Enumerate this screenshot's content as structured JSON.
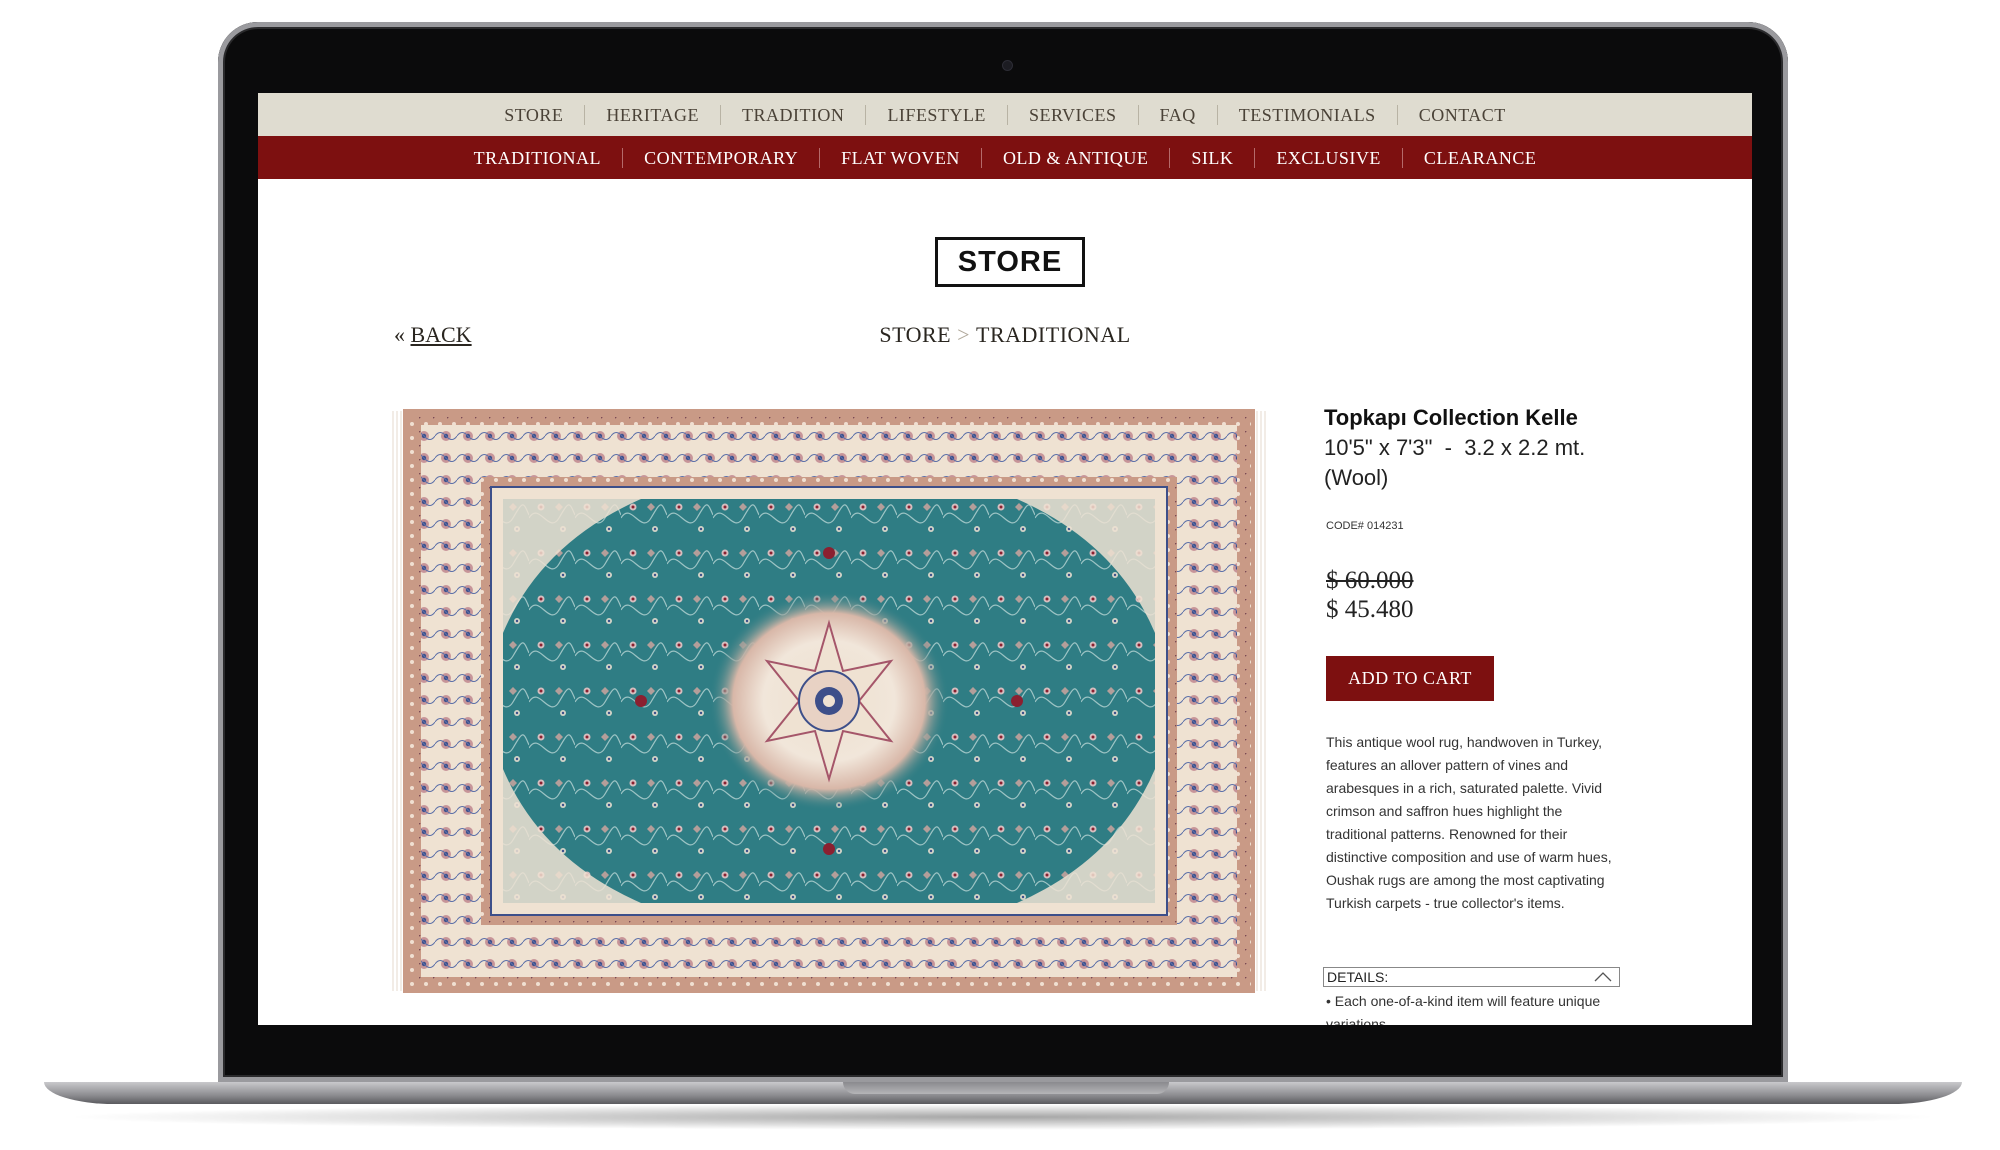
{
  "nav_main": [
    "STORE",
    "HERITAGE",
    "TRADITION",
    "LIFESTYLE",
    "SERVICES",
    "FAQ",
    "TESTIMONIALS",
    "CONTACT"
  ],
  "nav_sub": [
    "TRADITIONAL",
    "CONTEMPORARY",
    "FLAT WOVEN",
    "OLD & ANTIQUE",
    "SILK",
    "EXCLUSIVE",
    "CLEARANCE"
  ],
  "logo": "STORE",
  "back": {
    "arrow": "«",
    "label": "BACK"
  },
  "breadcrumb": {
    "root": "STORE",
    "sep": ">",
    "current": "TRADITIONAL"
  },
  "product": {
    "title": "Topkapı Collection Kelle",
    "dimensions": "10'5\" x 7'3\"  -  3.2 x 2.2 mt.",
    "material": "(Wool)",
    "code": "CODE# 014231",
    "price_old": "$ 60.000",
    "price_new": "$ 45.480",
    "add_to_cart": "ADD TO CART",
    "description": "This antique wool rug, handwoven in Turkey, features an allover pattern of vines and arabesques in a rich, saturated palette. Vivid crimson and saffron hues highlight the traditional patterns. Renowned for their distinctive composition and use of warm hues, Oushak rugs are among the most captivating Turkish carpets - true collector's items.",
    "details_label": "DETAILS:",
    "details_item": "• Each one-of-a-kind item will feature unique variations"
  },
  "colors": {
    "nav_main_bg": "#dfdcd0",
    "nav_sub_bg": "#7d1010",
    "button_bg": "#7d1010",
    "rug_field": "#2f7d84",
    "rug_cream": "#efe2d2",
    "rug_rose": "#c99a86"
  },
  "icons": {
    "details_toggle": "chevron-up-icon",
    "camera": "camera-icon"
  }
}
